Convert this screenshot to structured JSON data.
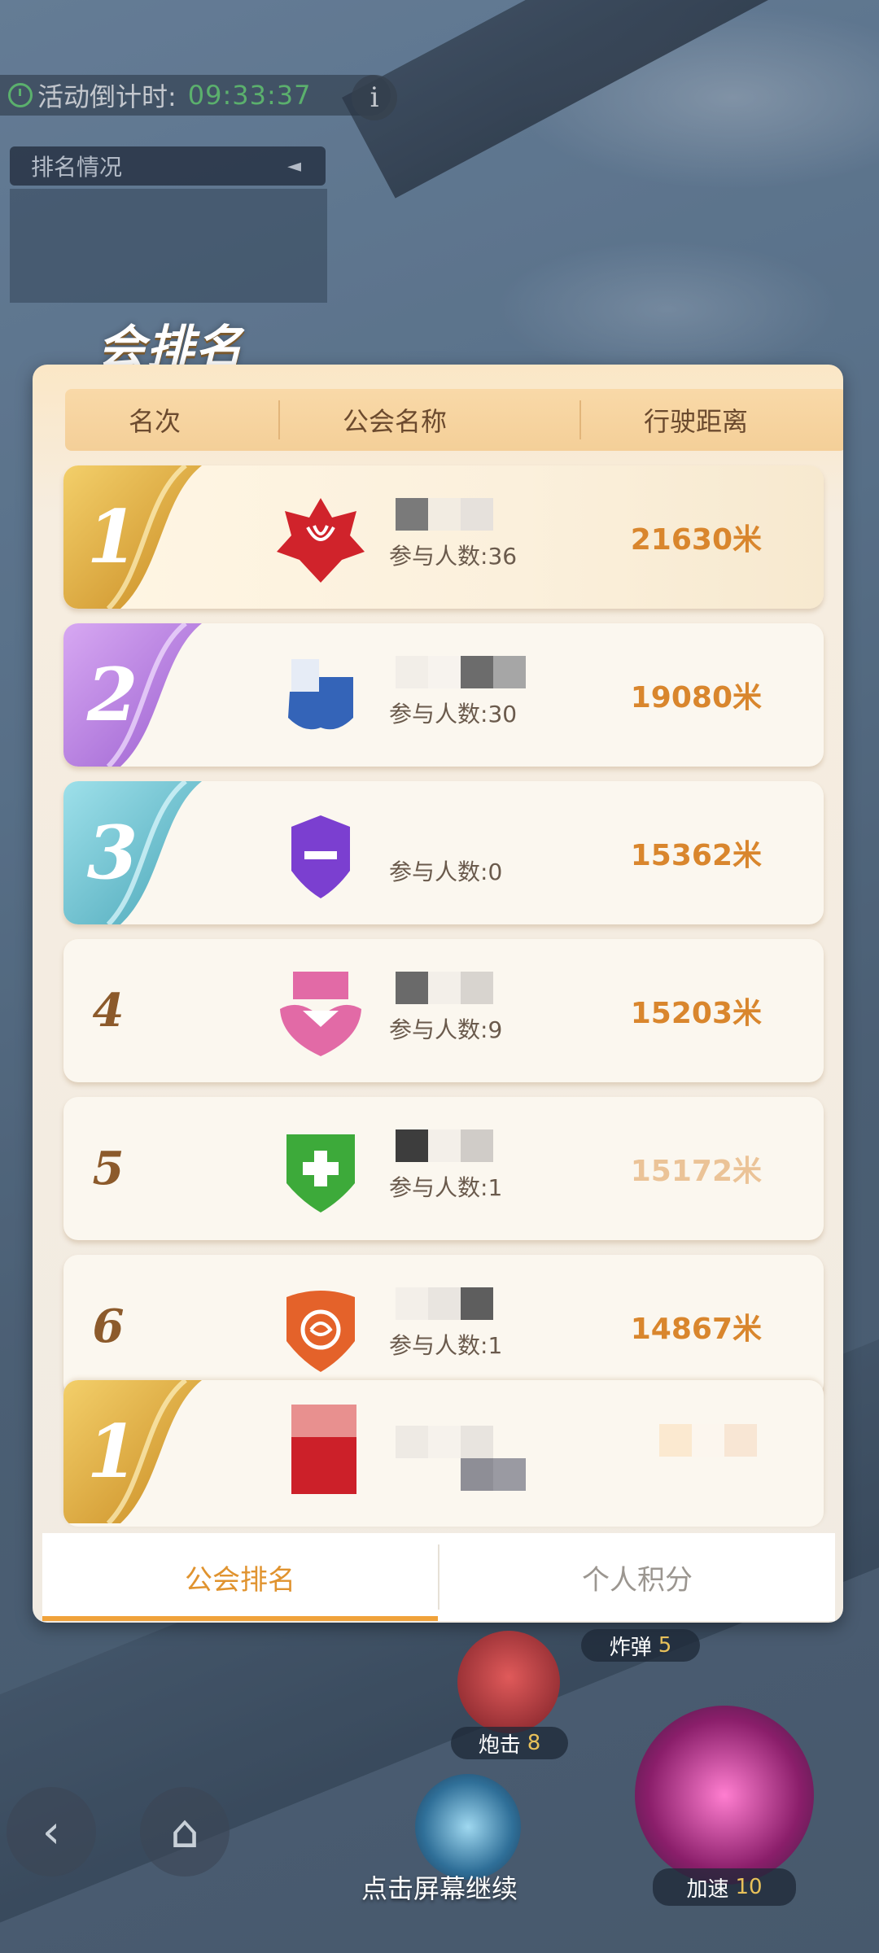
{
  "hud": {
    "countdown_label": "活动倒计时:",
    "countdown_time": "09:33:37",
    "info_icon": "i",
    "rank_status_label": "排名情况",
    "rank_status_arrow": "◄"
  },
  "panel": {
    "title": "会排名",
    "headers": {
      "rank": "名次",
      "name": "公会名称",
      "distance": "行驶距离"
    },
    "members_label": "参与人数:",
    "rows": [
      {
        "rank": "1",
        "members": "36",
        "distance": "21630米",
        "emblem": "red-star-emblem",
        "color": "#d0232b"
      },
      {
        "rank": "2",
        "members": "30",
        "distance": "19080米",
        "emblem": "blue-shield-emblem",
        "color": "#3464b8"
      },
      {
        "rank": "3",
        "members": "0",
        "distance": "15362米",
        "emblem": "purple-shield-emblem",
        "color": "#7b3fd0"
      },
      {
        "rank": "4",
        "members": "9",
        "distance": "15203米",
        "emblem": "pink-heart-emblem",
        "color": "#e26aa6"
      },
      {
        "rank": "5",
        "members": "1",
        "distance": "15172米",
        "emblem": "green-shield-emblem",
        "color": "#3daa3a"
      },
      {
        "rank": "6",
        "members": "1",
        "distance": "14867米",
        "emblem": "orange-rose-emblem",
        "color": "#e4622a"
      }
    ],
    "self_rank": "1",
    "tabs": {
      "guild": "公会排名",
      "personal": "个人积分"
    }
  },
  "skills": {
    "bomb_label": "炸弹",
    "bomb_count": "5",
    "cannon_label": "炮击",
    "cannon_count": "8",
    "boost_label": "加速",
    "boost_count": "10"
  },
  "continue_text": "点击屏幕继续",
  "colors": {
    "accent": "#e0932f",
    "distance": "#d9862d",
    "gold": "#d9a63a",
    "silver_purple": "#b07ad8",
    "bronze_teal": "#5db8c8"
  }
}
